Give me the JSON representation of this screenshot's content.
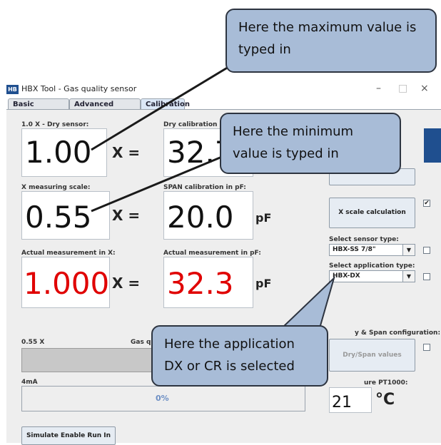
{
  "window": {
    "app_icon_label": "HB",
    "title": "HBX Tool - Gas quality sensor",
    "minimize_icon": "minimize-icon",
    "maximize_icon": "maximize-icon",
    "close_icon": "close-icon",
    "minimize_glyph": "–",
    "maximize_glyph": "□",
    "close_glyph": "×"
  },
  "tabs": [
    {
      "label": "Basic settings",
      "active": false
    },
    {
      "label": "Advanced settings",
      "active": false
    },
    {
      "label": "Calibration",
      "active": true
    }
  ],
  "calibration": {
    "dry_sensor_label": "1.0 X - Dry sensor:",
    "dry_sensor_value": "1.00",
    "dry_cal_label": "Dry calibration in pF:",
    "dry_cal_value": "32.7",
    "x_scale_label": "X measuring scale:",
    "x_scale_value": "0.55",
    "span_cal_label": "SPAN calibration in pF:",
    "span_cal_value": "20.0",
    "actual_x_label": "Actual measurement in X:",
    "actual_x_value": "1.000",
    "actual_pf_label": "Actual measurement in pF:",
    "actual_pf_value": "32.3",
    "x_equals": "X =",
    "unit_pf": "pF",
    "highlight_color": "#e00000"
  },
  "right_panel": {
    "x_scale_button": "X scale calculation",
    "x_scale_checked": true,
    "sensor_type_label": "Select sensor type:",
    "sensor_type_value": "HBX-SS 7/8\"",
    "application_type_label": "Select application type:",
    "application_type_value": "HBX-DX",
    "dry_span_config_label": "y & Span configuration:",
    "dry_span_button": "Dry/Span values",
    "temperature_label": "ure PT1000:",
    "temperature_value": "21",
    "temperature_unit": "°C"
  },
  "bottom": {
    "scale_left_label": "0.55 X",
    "gas_label": "Gas q",
    "current_label": "4mA",
    "progress_text": "0%",
    "progress_value": 0,
    "simulate_button": "Simulate Enable Run In"
  },
  "callouts": {
    "max": "Here the maximum value is typed in",
    "min": "Here the minimum value is typed in",
    "app": "Here the application DX or CR is selected",
    "color": "#a8bcd7"
  }
}
